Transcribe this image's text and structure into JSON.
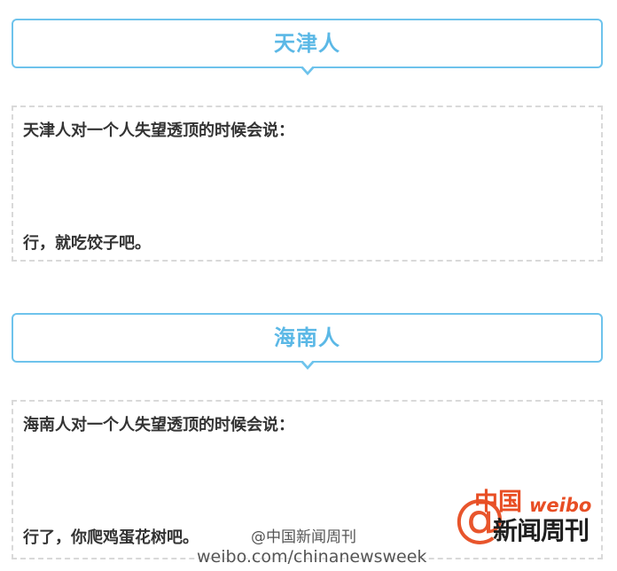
{
  "sections": [
    {
      "header": "天津人",
      "intro": "天津人对一个人失望透顶的时候会说：",
      "answer": "行，就吃饺子吧。"
    },
    {
      "header": "海南人",
      "intro": "海南人对一个人失望透顶的时候会说：",
      "answer": "行了，你爬鸡蛋花树吧。"
    }
  ],
  "watermark": {
    "at_symbol": "@",
    "logo_top": "中国",
    "logo_weibo": "weibo",
    "logo_brand": "新闻周刊",
    "handle": "@中国新闻周刊",
    "url": "weibo.com/chinanewsweek"
  },
  "colors": {
    "header_border": "#6ec3ec",
    "header_text": "#5bb8e6",
    "body_text": "#333333",
    "dashed_border": "#d9d9d9",
    "watermark_red": "#e84e24"
  }
}
